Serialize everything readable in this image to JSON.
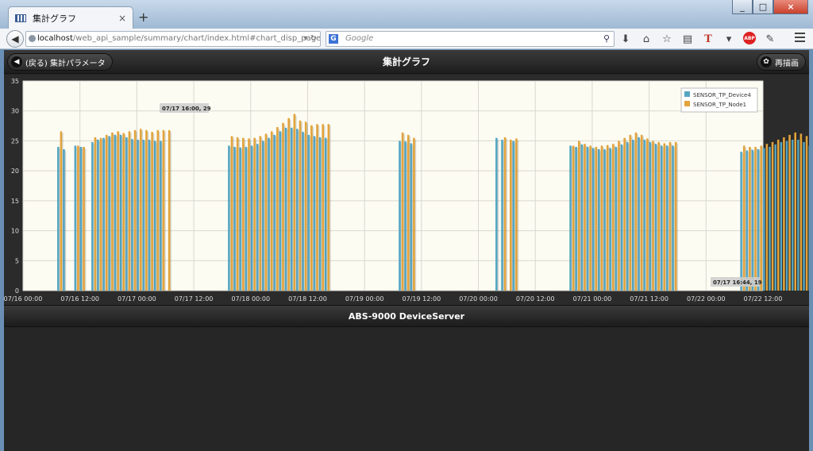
{
  "browser": {
    "tab_title": "集計グラフ",
    "tab_close": "×",
    "new_tab": "+",
    "url_host": "localhost",
    "url_path": "/web_api_sample/summary/chart/index.html#chart_disp_page",
    "search_placeholder": "Google",
    "search_engine": "G"
  },
  "page": {
    "back_button": "(戻る) 集計パラメータ",
    "title": "集計グラフ",
    "redraw_button": "再描画",
    "footer": "ABS-9000 DeviceServer"
  },
  "colors": {
    "device": "#56a7c3",
    "node": "#e2a43c",
    "plot_bg": "#fdfcf3"
  },
  "chart_data": {
    "type": "bar",
    "ylim": [
      0,
      35
    ],
    "yticks": [
      "0",
      "5",
      "10",
      "15",
      "20",
      "25",
      "30",
      "35"
    ],
    "xticks": [
      "07/16 00:00",
      "07/16 12:00",
      "07/17 00:00",
      "07/17 12:00",
      "07/18 00:00",
      "07/18 12:00",
      "07/19 00:00",
      "07/19 12:00",
      "07/20 00:00",
      "07/20 12:00",
      "07/21 00:00",
      "07/21 12:00",
      "07/22 00:00",
      "07/22 12:00"
    ],
    "annotations": [
      "07/17 16:00, 29",
      "07/17 16:44, 19"
    ],
    "series": [
      {
        "name": "SENSOR_TP_Device4",
        "values": [
          [
            0.6,
            24
          ],
          [
            0.7,
            23.6
          ],
          [
            0.9,
            24.2
          ],
          [
            1.0,
            24
          ],
          [
            1.2,
            24.8
          ],
          [
            1.3,
            25.2
          ],
          [
            1.4,
            25.5
          ],
          [
            1.5,
            25.8
          ],
          [
            1.6,
            26
          ],
          [
            1.7,
            26
          ],
          [
            1.8,
            25.6
          ],
          [
            1.9,
            25.3
          ],
          [
            2.0,
            25.2
          ],
          [
            2.1,
            25.2
          ],
          [
            2.2,
            25.2
          ],
          [
            2.3,
            25
          ],
          [
            2.4,
            25
          ],
          [
            3.6,
            24.2
          ],
          [
            3.7,
            24
          ],
          [
            3.8,
            23.9
          ],
          [
            3.9,
            24
          ],
          [
            4.0,
            24.2
          ],
          [
            4.1,
            24.5
          ],
          [
            4.2,
            25
          ],
          [
            4.3,
            25.5
          ],
          [
            4.4,
            26
          ],
          [
            4.5,
            26.6
          ],
          [
            4.6,
            27.2
          ],
          [
            4.7,
            27.2
          ],
          [
            4.8,
            27
          ],
          [
            4.9,
            26.5
          ],
          [
            5.0,
            26
          ],
          [
            5.1,
            25.8
          ],
          [
            5.2,
            25.6
          ],
          [
            5.3,
            25.5
          ],
          [
            6.6,
            25
          ],
          [
            6.7,
            24.9
          ],
          [
            6.8,
            24.6
          ],
          [
            8.3,
            25.5
          ],
          [
            8.4,
            25.2
          ],
          [
            8.6,
            25
          ],
          [
            9.6,
            24.2
          ],
          [
            9.7,
            24
          ],
          [
            9.8,
            24.4
          ],
          [
            9.9,
            24
          ],
          [
            10.0,
            23.8
          ],
          [
            10.1,
            23.6
          ],
          [
            10.2,
            23.6
          ],
          [
            10.3,
            23.8
          ],
          [
            10.4,
            24
          ],
          [
            10.5,
            24.4
          ],
          [
            10.6,
            24.8
          ],
          [
            10.7,
            25.2
          ],
          [
            10.8,
            25.6
          ],
          [
            10.9,
            25.2
          ],
          [
            11.0,
            24.8
          ],
          [
            11.1,
            24.5
          ],
          [
            11.2,
            24.2
          ],
          [
            11.3,
            24.2
          ],
          [
            11.4,
            24.2
          ],
          [
            12.6,
            23.2
          ],
          [
            12.7,
            23.4
          ],
          [
            12.8,
            23.5
          ],
          [
            12.9,
            23.6
          ],
          [
            13.0,
            23.8
          ],
          [
            13.1,
            24
          ],
          [
            13.2,
            24.4
          ],
          [
            13.3,
            24.8
          ],
          [
            13.4,
            25
          ],
          [
            13.5,
            25.2
          ],
          [
            13.6,
            25.2
          ],
          [
            13.7,
            24.8
          ],
          [
            13.8,
            24.2
          ],
          [
            13.9,
            24
          ],
          [
            14.0,
            24.2
          ],
          [
            14.1,
            24.4
          ],
          [
            15.6,
            23.4
          ],
          [
            15.7,
            23.2
          ],
          [
            15.8,
            23.4
          ],
          [
            17.3,
            25.8
          ],
          [
            17.4,
            25.6
          ],
          [
            17.5,
            25.4
          ],
          [
            17.6,
            25.4
          ],
          [
            17.7,
            25.8
          ],
          [
            18.6,
            24.5
          ],
          [
            18.7,
            24.5
          ],
          [
            18.8,
            24.4
          ],
          [
            18.9,
            24.4
          ],
          [
            19.0,
            24.4
          ],
          [
            19.1,
            24.4
          ],
          [
            19.2,
            24.4
          ],
          [
            19.3,
            24.5
          ],
          [
            19.4,
            24.6
          ],
          [
            19.5,
            24.8
          ]
        ]
      },
      {
        "name": "SENSOR_TP_Node1",
        "values": [
          [
            0.65,
            26.6
          ],
          [
            0.95,
            24.2
          ],
          [
            1.05,
            24
          ],
          [
            1.25,
            25.6
          ],
          [
            1.35,
            25.5
          ],
          [
            1.45,
            26
          ],
          [
            1.55,
            26.4
          ],
          [
            1.65,
            26.6
          ],
          [
            1.75,
            26.3
          ],
          [
            1.85,
            26.6
          ],
          [
            1.95,
            26.8
          ],
          [
            2.05,
            27
          ],
          [
            2.15,
            26.8
          ],
          [
            2.25,
            26.5
          ],
          [
            2.35,
            26.8
          ],
          [
            2.45,
            26.8
          ],
          [
            2.55,
            26.8
          ],
          [
            3.65,
            25.8
          ],
          [
            3.75,
            25.6
          ],
          [
            3.85,
            25.5
          ],
          [
            3.95,
            25.4
          ],
          [
            4.05,
            25.5
          ],
          [
            4.15,
            25.8
          ],
          [
            4.25,
            26.2
          ],
          [
            4.35,
            26.6
          ],
          [
            4.45,
            27.3
          ],
          [
            4.55,
            28
          ],
          [
            4.65,
            28.8
          ],
          [
            4.75,
            29.5
          ],
          [
            4.85,
            28.4
          ],
          [
            4.95,
            28.2
          ],
          [
            5.05,
            27.6
          ],
          [
            5.15,
            27.8
          ],
          [
            5.25,
            27.8
          ],
          [
            5.35,
            27.8
          ],
          [
            6.65,
            26.4
          ],
          [
            6.75,
            26
          ],
          [
            6.85,
            25.5
          ],
          [
            8.45,
            25.6
          ],
          [
            8.55,
            25.2
          ],
          [
            8.65,
            25.4
          ],
          [
            9.65,
            24.2
          ],
          [
            9.75,
            25
          ],
          [
            9.85,
            24.5
          ],
          [
            9.95,
            24.2
          ],
          [
            10.05,
            24
          ],
          [
            10.15,
            24.2
          ],
          [
            10.25,
            24.3
          ],
          [
            10.35,
            24.5
          ],
          [
            10.45,
            25
          ],
          [
            10.55,
            25.5
          ],
          [
            10.65,
            26
          ],
          [
            10.75,
            26.4
          ],
          [
            10.85,
            26
          ],
          [
            10.95,
            25.4
          ],
          [
            11.05,
            25
          ],
          [
            11.15,
            24.8
          ],
          [
            11.25,
            24.6
          ],
          [
            11.35,
            24.8
          ],
          [
            11.45,
            24.8
          ],
          [
            12.65,
            24.2
          ],
          [
            12.75,
            24
          ],
          [
            12.85,
            24
          ],
          [
            12.95,
            24.2
          ],
          [
            13.05,
            24.5
          ],
          [
            13.15,
            24.8
          ],
          [
            13.25,
            25.2
          ],
          [
            13.35,
            25.6
          ],
          [
            13.45,
            26
          ],
          [
            13.55,
            26.4
          ],
          [
            13.65,
            26.2
          ],
          [
            13.75,
            25.8
          ],
          [
            13.85,
            25
          ],
          [
            13.95,
            24.6
          ],
          [
            14.05,
            24.6
          ],
          [
            14.15,
            24.8
          ],
          [
            15.75,
            24.2
          ],
          [
            15.85,
            24.6
          ],
          [
            15.95,
            24.8
          ],
          [
            17.35,
            26.4
          ],
          [
            17.45,
            26.2
          ],
          [
            17.55,
            25.8
          ],
          [
            17.65,
            26.4
          ],
          [
            17.75,
            26.4
          ],
          [
            18.65,
            25.6
          ],
          [
            18.75,
            25.6
          ],
          [
            18.85,
            25.4
          ],
          [
            18.95,
            25.4
          ],
          [
            19.05,
            25.6
          ],
          [
            19.15,
            25.6
          ],
          [
            19.25,
            25.6
          ],
          [
            19.35,
            25.6
          ],
          [
            19.45,
            25.6
          ],
          [
            19.55,
            25.4
          ]
        ]
      }
    ],
    "legend_position": "top-right",
    "grid": true
  }
}
